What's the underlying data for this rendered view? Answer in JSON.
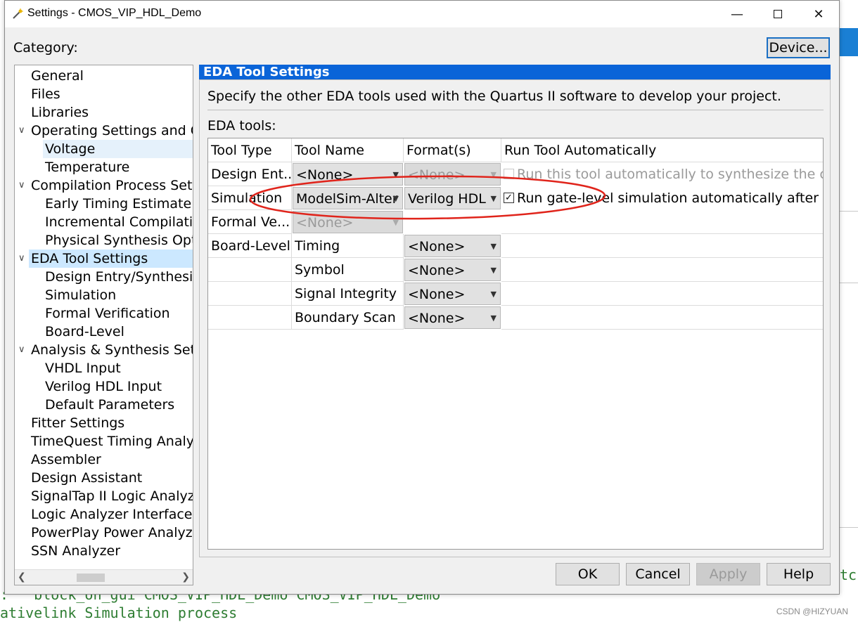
{
  "window": {
    "title": "Settings - CMOS_VIP_HDL_Demo"
  },
  "category_label": "Category:",
  "device_button": "Device...",
  "tree": [
    {
      "label": "General",
      "level": 0
    },
    {
      "label": "Files",
      "level": 0
    },
    {
      "label": "Libraries",
      "level": 0
    },
    {
      "label": "Operating Settings and Co",
      "level": 0,
      "expanded": true
    },
    {
      "label": "Voltage",
      "level": 1
    },
    {
      "label": "Temperature",
      "level": 1
    },
    {
      "label": "Compilation Process Settin",
      "level": 0,
      "expanded": true
    },
    {
      "label": "Early Timing Estimate",
      "level": 1
    },
    {
      "label": "Incremental Compilatio",
      "level": 1
    },
    {
      "label": "Physical Synthesis Optin",
      "level": 1
    },
    {
      "label": "EDA Tool Settings",
      "level": 0,
      "expanded": true,
      "selected": true
    },
    {
      "label": "Design Entry/Synthesis",
      "level": 1
    },
    {
      "label": "Simulation",
      "level": 1
    },
    {
      "label": "Formal Verification",
      "level": 1
    },
    {
      "label": "Board-Level",
      "level": 1
    },
    {
      "label": "Analysis & Synthesis Setti",
      "level": 0,
      "expanded": true
    },
    {
      "label": "VHDL Input",
      "level": 1
    },
    {
      "label": "Verilog HDL Input",
      "level": 1
    },
    {
      "label": "Default Parameters",
      "level": 1
    },
    {
      "label": "Fitter Settings",
      "level": 0
    },
    {
      "label": "TimeQuest Timing Analyz",
      "level": 0
    },
    {
      "label": "Assembler",
      "level": 0
    },
    {
      "label": "Design Assistant",
      "level": 0
    },
    {
      "label": "SignalTap II Logic Analyze",
      "level": 0
    },
    {
      "label": "Logic Analyzer Interface",
      "level": 0
    },
    {
      "label": "PowerPlay Power Analyze",
      "level": 0
    },
    {
      "label": "SSN Analyzer",
      "level": 0
    }
  ],
  "panel": {
    "header": "EDA Tool Settings",
    "description": "Specify the other EDA tools used with the Quartus II software to develop your project.",
    "eda_label": "EDA tools:",
    "columns": [
      "Tool Type",
      "Tool Name",
      "Format(s)",
      "Run Tool Automatically"
    ],
    "rows": {
      "design_entry": {
        "type": "Design Ent...",
        "tool": "<None>",
        "format": "<None>",
        "run": "Run this tool automatically to synthesize the curr"
      },
      "simulation": {
        "type": "Simulation",
        "tool": "ModelSim-Alter",
        "format": "Verilog HDL",
        "run": "Run gate-level simulation automatically after cor"
      },
      "formal": {
        "type": "Formal Ve...",
        "tool": "<None>"
      },
      "board_level": {
        "type": "Board-Level"
      },
      "board": [
        {
          "name": "Timing",
          "format": "<None>"
        },
        {
          "name": "Symbol",
          "format": "<None>"
        },
        {
          "name": "Signal Integrity",
          "format": "<None>"
        },
        {
          "name": "Boundary Scan",
          "format": "<None>"
        }
      ]
    }
  },
  "buttons": {
    "ok": "OK",
    "cancel": "Cancel",
    "apply": "Apply",
    "help": "Help"
  },
  "background": {
    "line1": ":   block_on_gui CMOS_VIP_HDL_Demo CMOS_VIP_HDL_Demo",
    "line2": "ativelink Simulation process",
    "edge_text": "tc"
  },
  "watermark": "CSDN @HIZYUAN",
  "colors": {
    "accent": "#0a64d8",
    "annotation": "#e0241b",
    "console_text": "#2e7d32"
  }
}
